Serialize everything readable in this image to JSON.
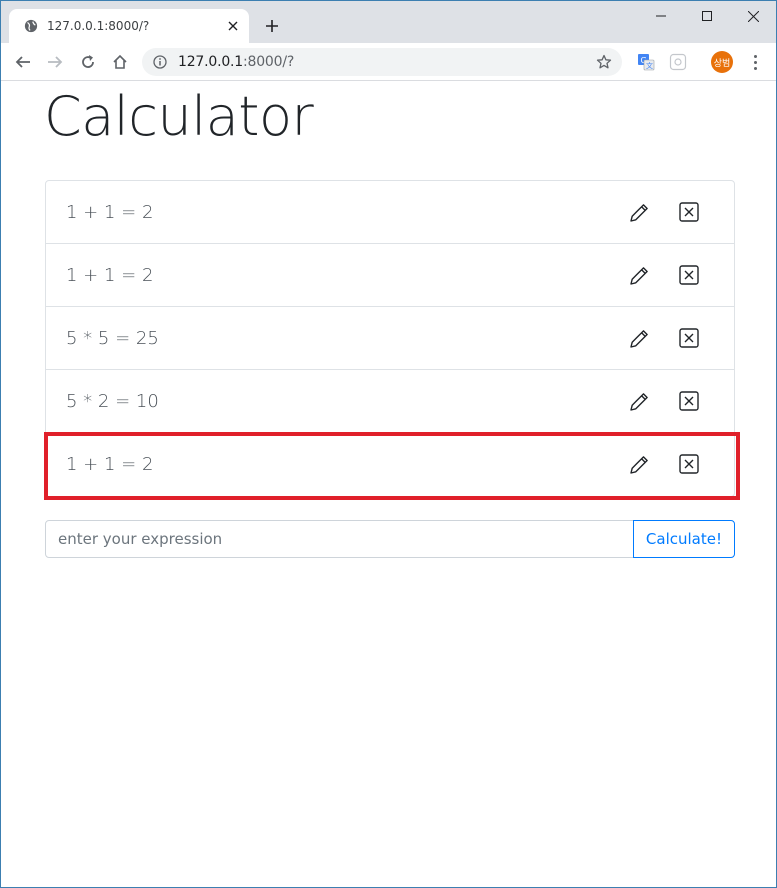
{
  "browser": {
    "tab_title": "127.0.0.1:8000/?",
    "url_host": "127.0.0.1",
    "url_rest": ":8000/?",
    "avatar_text": "상범",
    "icons": {
      "tab": "globe-icon",
      "tab_close": "close-icon",
      "new_tab": "plus-icon",
      "back": "arrow-left-icon",
      "forward": "arrow-right-icon",
      "reload": "reload-icon",
      "home": "home-icon",
      "info": "info-icon",
      "bookmark": "star-icon",
      "translate": "translate-icon",
      "extension": "extension-icon",
      "menu": "more-vert-icon"
    }
  },
  "page": {
    "title": "Calculator",
    "calculations": [
      {
        "expression": "1 + 1 = 2"
      },
      {
        "expression": "1 + 1 = 2"
      },
      {
        "expression": "5 * 5 = 25"
      },
      {
        "expression": "5 * 2 = 10"
      },
      {
        "expression": "1 + 1 = 2"
      }
    ],
    "highlight_color": "#e0202a",
    "input_placeholder": "enter your expression",
    "calculate_label": "Calculate!",
    "accent_color": "#007bff"
  }
}
